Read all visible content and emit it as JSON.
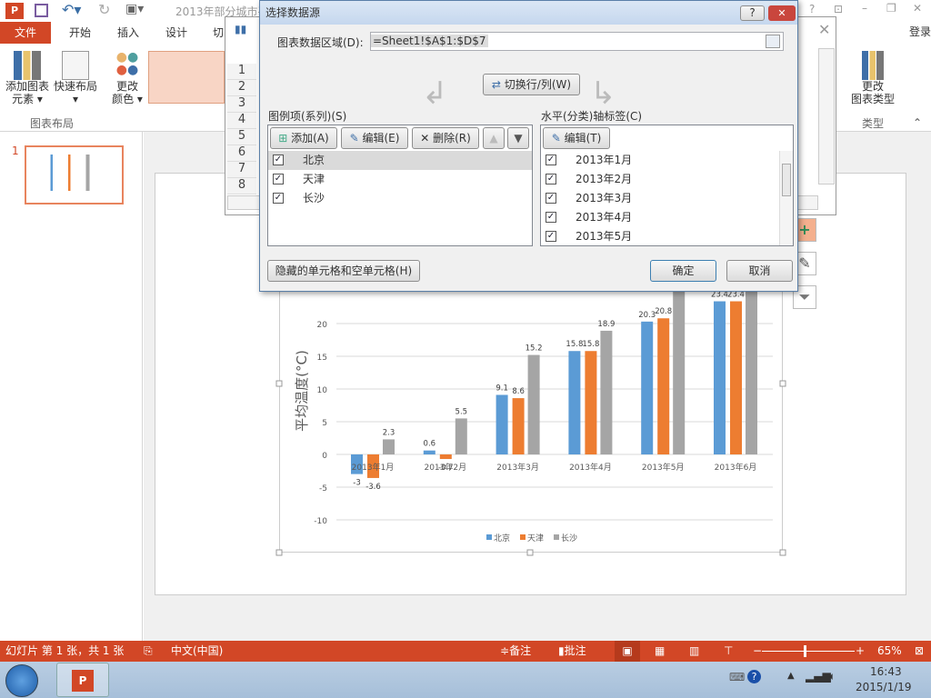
{
  "app": {
    "title": "2013年部分城市平",
    "login": "登录",
    "tabs": [
      "开始",
      "插入",
      "设计",
      "切"
    ],
    "file_tab": "文件"
  },
  "ribbon": {
    "add_element": [
      "添加图表",
      "元素 ▾"
    ],
    "quick_layout": [
      "快速布局",
      "▾"
    ],
    "change_color": [
      "更改",
      "颜色 ▾"
    ],
    "group_layout": "图表布局",
    "change_type": [
      "更改",
      "图表类型"
    ],
    "group_type": "类型"
  },
  "slides": {
    "number": "1"
  },
  "sheet": {
    "rows": [
      "1",
      "2",
      "3",
      "4",
      "5",
      "6",
      "7",
      "8"
    ]
  },
  "dialog": {
    "title": "选择数据源",
    "help": "?",
    "close": "✕",
    "range_label": "图表数据区域(D):",
    "range_value": "=Sheet1!$A$1:$D$7",
    "switch_label": "切换行/列(W)",
    "legend_label": "图例项(系列)(S)",
    "add": "添加(A)",
    "edit": "编辑(E)",
    "delete": "删除(R)",
    "series": [
      {
        "name": "北京",
        "checked": true,
        "selected": true
      },
      {
        "name": "天津",
        "checked": true
      },
      {
        "name": "长沙",
        "checked": true
      }
    ],
    "axis_label": "水平(分类)轴标签(C)",
    "axis_edit": "编辑(T)",
    "categories": [
      {
        "name": "2013年1月",
        "checked": true
      },
      {
        "name": "2013年2月",
        "checked": true
      },
      {
        "name": "2013年3月",
        "checked": true
      },
      {
        "name": "2013年4月",
        "checked": true
      },
      {
        "name": "2013年5月",
        "checked": true
      }
    ],
    "hidden_cells": "隐藏的单元格和空单元格(H)",
    "ok": "确定",
    "cancel": "取消"
  },
  "chart_data": {
    "type": "bar",
    "ylabel": "平均温度(°C)",
    "categories": [
      "2013年1月",
      "2013年2月",
      "2013年3月",
      "2013年4月",
      "2013年5月",
      "2013年6月"
    ],
    "series": [
      {
        "name": "北京",
        "color": "#5b9bd5",
        "values": [
          -3,
          0.6,
          9.1,
          15.8,
          20.3,
          23.4
        ]
      },
      {
        "name": "天津",
        "color": "#ed7d31",
        "values": [
          -3.6,
          -0.7,
          8.6,
          15.8,
          20.8,
          23.4
        ]
      },
      {
        "name": "长沙",
        "color": "#a5a5a5",
        "values": [
          2.3,
          5.5,
          15.2,
          18.9,
          26.0,
          28.0
        ]
      }
    ],
    "yticks": [
      "-10",
      "-5",
      "0",
      "5",
      "10",
      "15",
      "20"
    ],
    "ylim": [
      -10,
      25
    ],
    "legend": "bottom",
    "grid": true
  },
  "status": {
    "slide_info": "幻灯片 第 1 张，共 1 张",
    "language": "中文(中国)",
    "notes": "备注",
    "comments": "批注",
    "zoom": "65%",
    "zoom_fraction": 0.45
  },
  "taskbar": {
    "time": "16:43",
    "date": "2015/1/19"
  }
}
